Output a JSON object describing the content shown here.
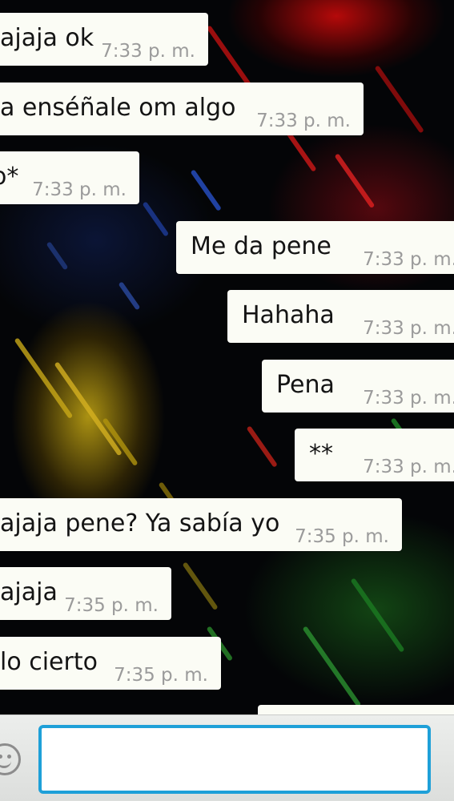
{
  "conversation": {
    "messages": [
      {
        "direction": "incoming",
        "text": "ajaja ok",
        "time": "7:33 p. m."
      },
      {
        "direction": "incoming",
        "text": "a enséñale om algo",
        "time": "7:33 p. m."
      },
      {
        "direction": "incoming",
        "text": "o*",
        "time": "7:33 p. m."
      },
      {
        "direction": "outgoing",
        "text": "Me da pene",
        "time": "7:33 p. m."
      },
      {
        "direction": "outgoing",
        "text": "Hahaha",
        "time": "7:33 p. m."
      },
      {
        "direction": "outgoing",
        "text": "Pena",
        "time": "7:33 p. m."
      },
      {
        "direction": "outgoing",
        "text": "**",
        "time": "7:33 p. m."
      },
      {
        "direction": "incoming",
        "text": "ajaja pene? Ya sabía yo",
        "time": "7:35 p. m."
      },
      {
        "direction": "incoming",
        "text": "ajaja",
        "time": "7:35 p. m."
      },
      {
        "direction": "incoming",
        "text": "lo cierto",
        "time": "7:35 p. m."
      }
    ]
  },
  "composer": {
    "emoji_icon": "smiley-face-icon",
    "input_value": "",
    "input_border_color": "#1ea0d8"
  },
  "colors": {
    "bubble_background": "#fbfcf5",
    "timestamp": "#9b9b9b",
    "message_text": "#141414"
  }
}
